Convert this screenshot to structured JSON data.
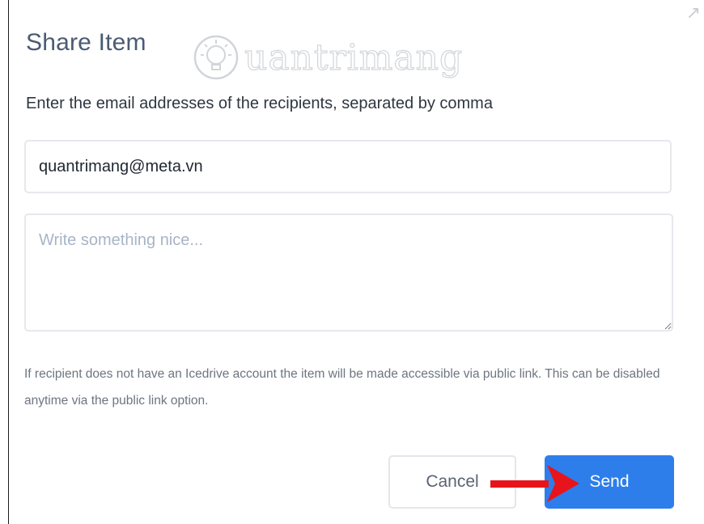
{
  "dialog": {
    "title": "Share Item",
    "instruction": "Enter the email addresses of the recipients, separated by comma",
    "recipients_value": "quantrimang@meta.vn",
    "message_value": "",
    "message_placeholder": "Write something nice...",
    "notice": "If recipient does not have an Icedrive account the item will be made accessible via public link. This can be disabled anytime via the public link option.",
    "cancel_label": "Cancel",
    "send_label": "Send"
  },
  "watermark": {
    "text": "uantrimang"
  },
  "annotation": {
    "arrow_color": "#e8141b",
    "points_to": "send-button"
  },
  "colors": {
    "accent": "#2d7eea",
    "title": "#4b5b72",
    "notice": "#6d7580"
  }
}
